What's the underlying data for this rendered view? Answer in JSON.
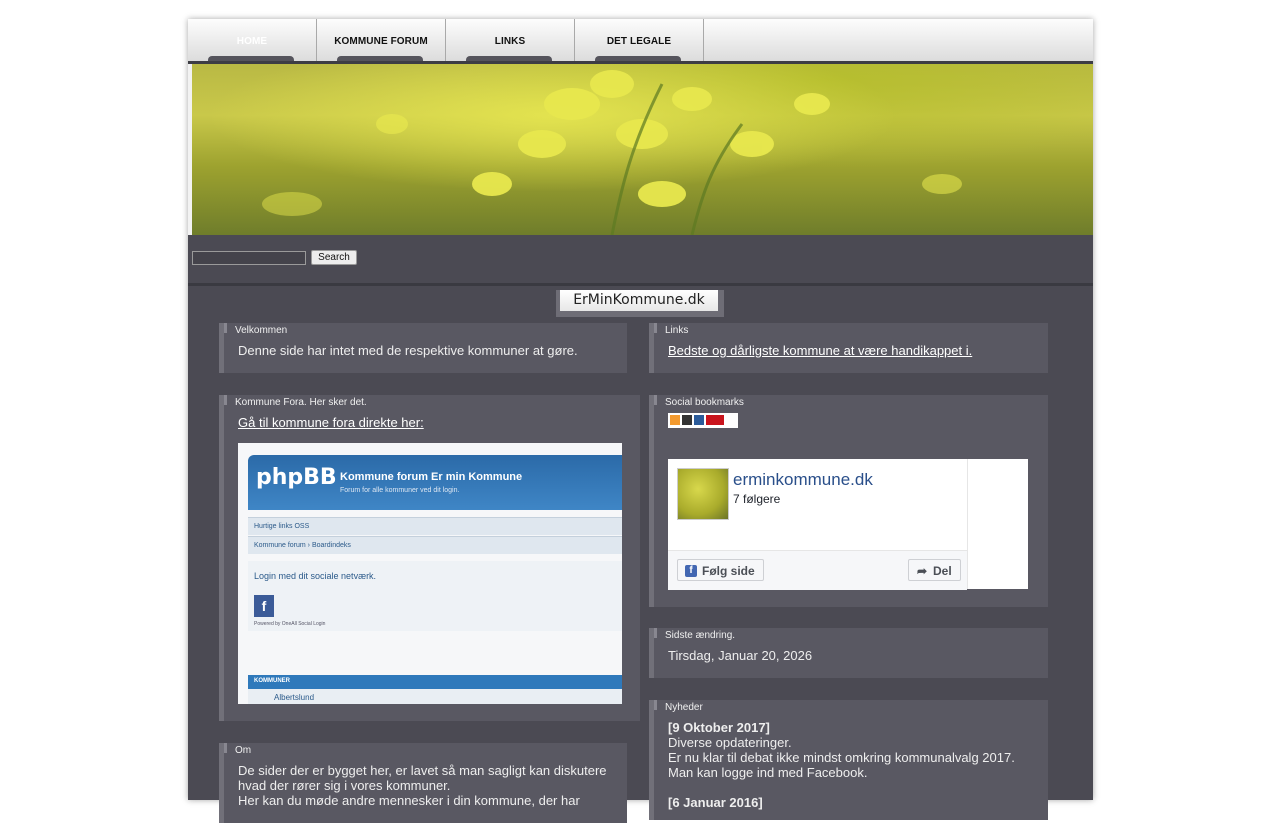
{
  "nav": {
    "items": [
      {
        "label": "HOME",
        "active": true
      },
      {
        "label": "KOMMUNE FORUM",
        "active": false
      },
      {
        "label": "LINKS",
        "active": false
      },
      {
        "label": "DET LEGALE",
        "active": false
      }
    ]
  },
  "search": {
    "value": "",
    "button_label": "Search"
  },
  "site_title": "ErMinKommune.dk",
  "widgets": {
    "velkommen": {
      "title": "Velkommen",
      "text": "Denne side har intet med de respektive kommuner at gøre."
    },
    "links": {
      "title": "Links",
      "link_text": "Bedste og dårligste kommune at være handikappet i."
    },
    "kommune_fora": {
      "title": "Kommune Fora. Her sker det.",
      "link_text": "Gå til kommune fora direkte her:",
      "preview": {
        "logo": "phpBB",
        "forum_title": "Kommune forum Er min Kommune",
        "forum_subtitle": "Forum for alle kommuner ved dit login.",
        "quick_links": "Hurtige links  OSS",
        "breadcrumb": "Kommune forum › Boardindeks",
        "login_text": "Login med dit sociale netværk.",
        "powered": "Powered by OneAll Social Login",
        "list_header": "KOMMUNER",
        "list_item": "Albertslund"
      }
    },
    "social": {
      "title": "Social bookmarks",
      "facebook": {
        "page_name": "erminkommune.dk",
        "followers": "7 følgere",
        "follow_label": "Følg side",
        "share_label": "Del"
      }
    },
    "sidste": {
      "title": "Sidste ændring.",
      "date": "Tirsdag, Januar 20, 2026"
    },
    "om": {
      "title": "Om",
      "text1": "De sider der er bygget her, er lavet så man sagligt kan diskutere hvad der rører sig i vores kommuner.",
      "text2": "Her kan du møde andre mennesker i din kommune, der har"
    },
    "nyheder": {
      "title": "Nyheder",
      "entry1_date": "[9 Oktober 2017]",
      "entry1_lines": [
        "Diverse opdateringer.",
        "Er nu klar til debat ikke mindst omkring kommunalvalg 2017.",
        "Man kan logge ind med Facebook."
      ],
      "entry2_date": "[6 Januar 2016]"
    }
  },
  "colors": {
    "page_bg": "#4b4a53",
    "widget_bg": "#595862",
    "facebook_blue": "#4267b2"
  }
}
